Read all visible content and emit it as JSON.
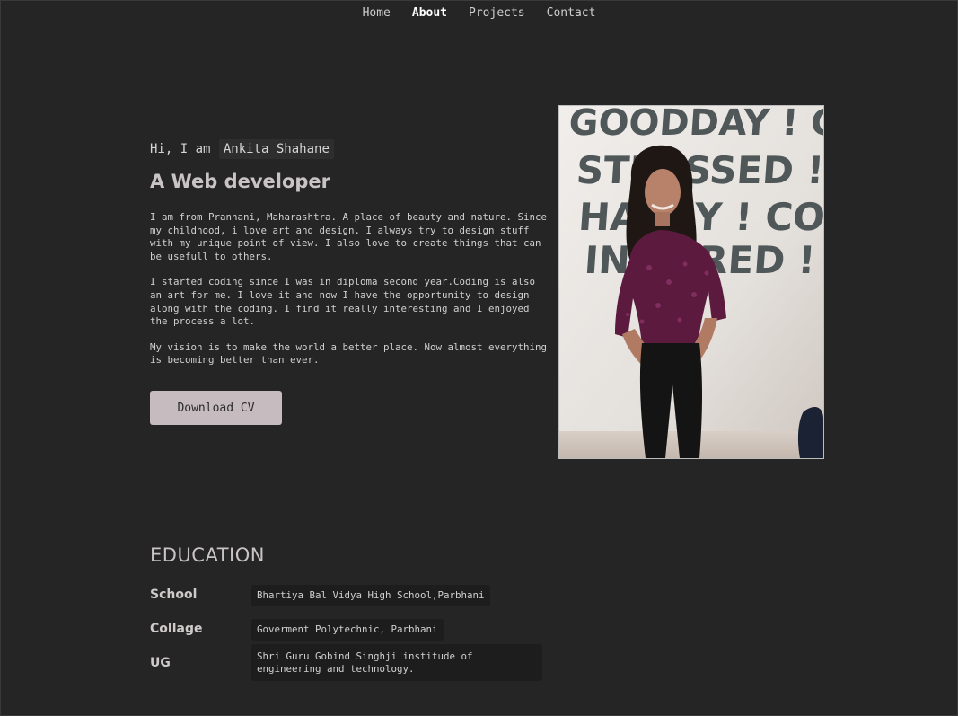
{
  "nav": {
    "items": [
      {
        "label": "Home",
        "active": false
      },
      {
        "label": "About",
        "active": true
      },
      {
        "label": "Projects",
        "active": false
      },
      {
        "label": "Contact",
        "active": false
      }
    ]
  },
  "intro": {
    "greeting_prefix": "Hi, I am",
    "name": "Ankita Shahane",
    "role": "A Web developer",
    "paragraphs": [
      "I am from Pranhani, Maharashtra. A place of beauty and nature. Since my childhood, i love art and design. I always try to design stuff with my unique point of view. I also love to create things that can be usefull to others.",
      "I started coding since I was in diploma second year.Coding is also an art for me. I love it and now I have the opportunity to design along with the coding. I find it really interesting and I enjoyed the process a lot.",
      "My vision is to make the world a better place. Now almost everything is becoming better than ever."
    ],
    "cv_button": "Download CV"
  },
  "photo": {
    "wall_text": [
      "GOODDAY ! CO",
      "STRESSED ! CO",
      "HAPPY ! COFF",
      "INSPIRED ! CO"
    ]
  },
  "education": {
    "title": "EDUCATION",
    "rows": [
      {
        "label": "School",
        "value": "Bhartiya Bal Vidya High School,Parbhani"
      },
      {
        "label": "Collage",
        "value": "Goverment Polytechnic, Parbhani"
      },
      {
        "label": "UG",
        "value": "Shri Guru Gobind Singhji institude of engineering and technology."
      }
    ]
  },
  "colors": {
    "background": "#252525",
    "button": "#c6bcc0",
    "heading": "#c9c3c6"
  }
}
